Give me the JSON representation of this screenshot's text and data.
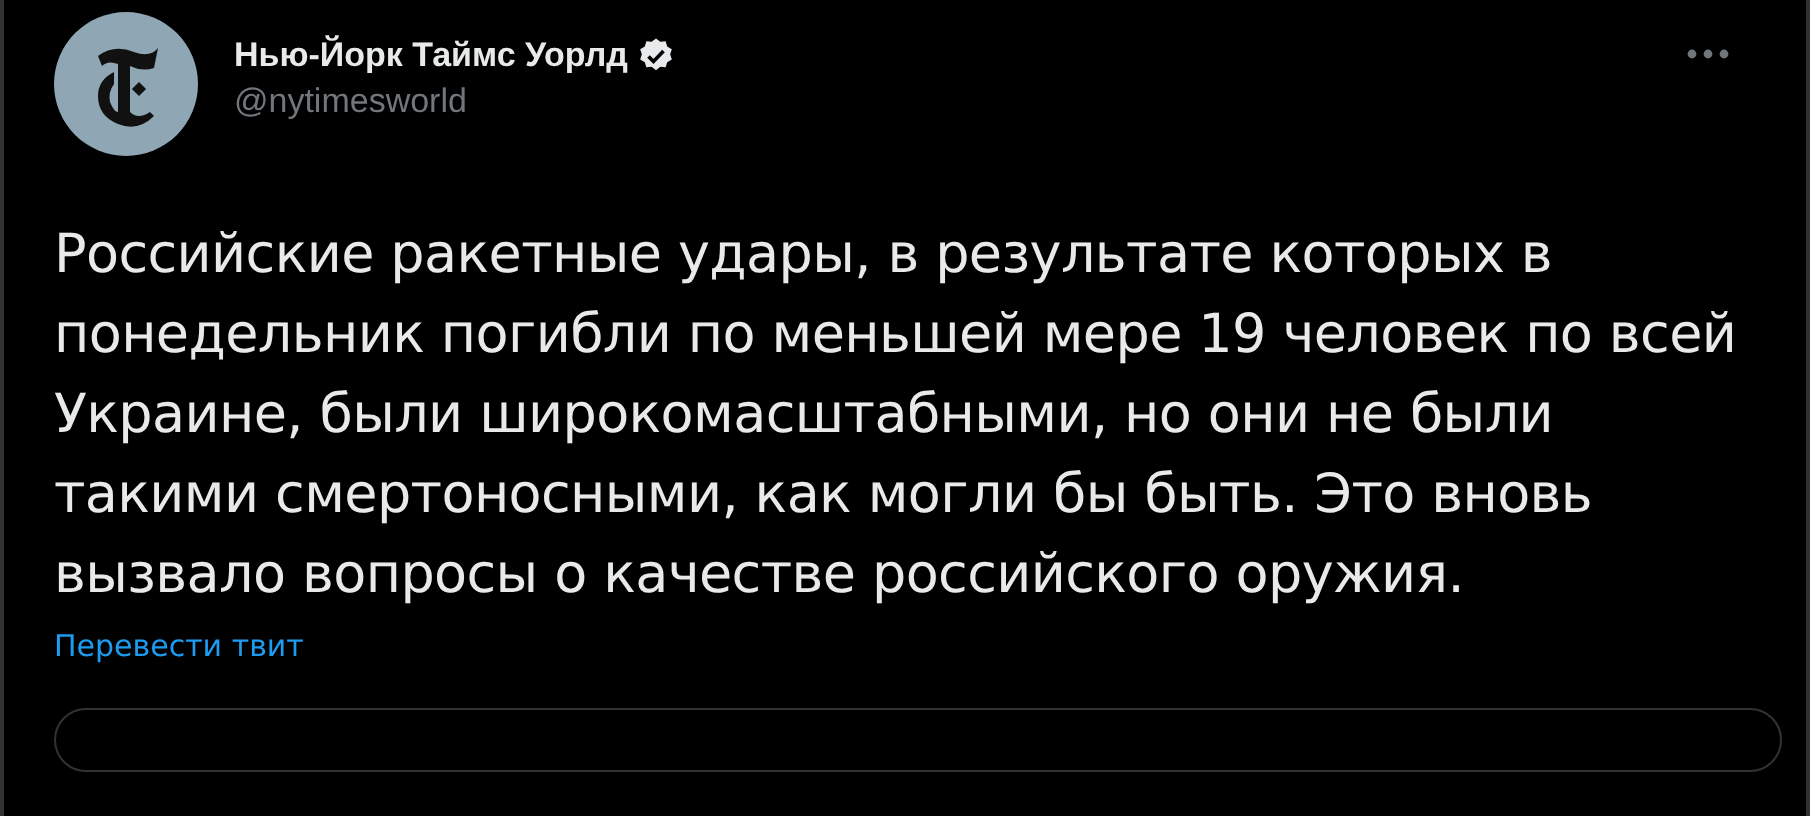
{
  "author": {
    "name": "Нью-Йорк Таймс Уорлд",
    "verified": true,
    "handle": "@nytimesworld"
  },
  "text": "Российские ракетные удары, в результате которых в понедельник погибли по меньшей мере 19 человек по всей Украине, были широкомасштабными, но они не были такими смертоносными, как могли бы быть. Это вновь вызвало вопросы о качестве российского оружия.",
  "translate_link": "Перевести твит"
}
